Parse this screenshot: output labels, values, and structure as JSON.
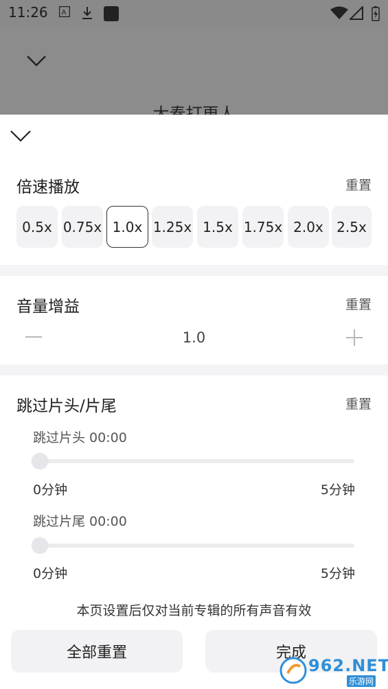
{
  "status_bar": {
    "time": "11:26",
    "icons": [
      "a-box-icon",
      "download-icon",
      "square-icon",
      "wifi-icon",
      "signal-icon",
      "battery-charging-icon"
    ]
  },
  "background": {
    "title": "大奏打更人"
  },
  "speed": {
    "title": "倍速播放",
    "reset": "重置",
    "options": [
      "0.5x",
      "0.75x",
      "1.0x",
      "1.25x",
      "1.5x",
      "1.75x",
      "2.0x",
      "2.5x"
    ],
    "selected": "1.0x"
  },
  "volume": {
    "title": "音量增益",
    "reset": "重置",
    "value": "1.0"
  },
  "skip": {
    "title": "跳过片头/片尾",
    "reset": "重置",
    "intro_label": "跳过片头 00:00",
    "intro_min": "0分钟",
    "intro_max": "5分钟",
    "intro_fraction": 0,
    "outro_label": "跳过片尾 00:00",
    "outro_min": "0分钟",
    "outro_max": "5分钟",
    "outro_fraction": 0
  },
  "notice": "本页设置后仅对当前专辑的所有声音有效",
  "buttons": {
    "reset_all": "全部重置",
    "done": "完成"
  },
  "watermark": {
    "brand": "962.NET",
    "sub": "乐游网"
  }
}
